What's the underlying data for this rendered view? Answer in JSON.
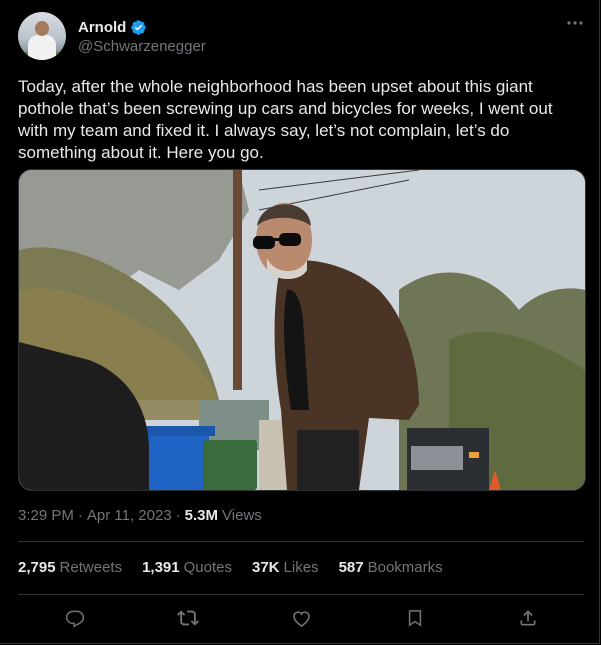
{
  "author": {
    "name": "Arnold",
    "handle": "@Schwarzenegger",
    "verified": true
  },
  "tweet": {
    "text": "Today, after the whole neighborhood has been upset about this giant pothole that’s been screwing up cars and bicycles for weeks, I went out with my team and fixed it. I always say, let’s not complain, let’s do something about it. Here you go."
  },
  "meta": {
    "time": "3:29 PM",
    "date": "Apr 11, 2023",
    "views_count": "5.3M",
    "views_label": "Views",
    "separator": "·"
  },
  "stats": {
    "retweets": {
      "count": "2,795",
      "label": "Retweets"
    },
    "quotes": {
      "count": "1,391",
      "label": "Quotes"
    },
    "likes": {
      "count": "37K",
      "label": "Likes"
    },
    "bookmarks": {
      "count": "587",
      "label": "Bookmarks"
    }
  },
  "icons": {
    "more": "more-icon",
    "reply": "reply-icon",
    "retweet": "retweet-icon",
    "like": "like-icon",
    "bookmark": "bookmark-icon",
    "share": "share-icon",
    "verified": "verified-badge-icon"
  },
  "colors": {
    "background": "#000000",
    "text": "#e7e9ea",
    "secondary": "#71767b",
    "verified": "#1d9bf0",
    "border": "#2f3336"
  }
}
